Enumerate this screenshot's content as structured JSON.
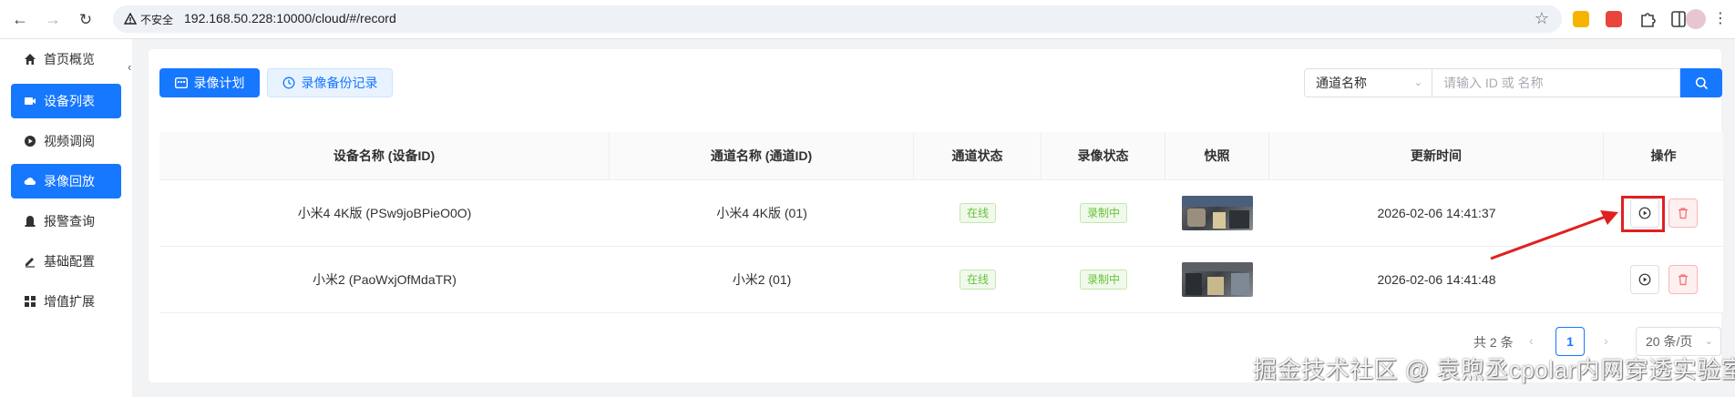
{
  "browser": {
    "insecure_label": "不安全",
    "url": "192.168.50.228:10000/cloud/#/record"
  },
  "sidebar": {
    "items": [
      {
        "label": "首页概览",
        "icon": "home-icon",
        "active": false
      },
      {
        "label": "设备列表",
        "icon": "camera-icon",
        "active": true
      },
      {
        "label": "视频调阅",
        "icon": "play-circle-icon",
        "active": false
      },
      {
        "label": "录像回放",
        "icon": "cloud-icon",
        "active": true
      },
      {
        "label": "报警查询",
        "icon": "alarm-icon",
        "active": false
      },
      {
        "label": "基础配置",
        "icon": "edit-icon",
        "active": false
      },
      {
        "label": "增值扩展",
        "icon": "grid-icon",
        "active": false
      }
    ]
  },
  "toolbar": {
    "plan_label": "录像计划",
    "backup_label": "录像备份记录"
  },
  "search": {
    "select_value": "通道名称",
    "placeholder": "请输入 ID 或 名称"
  },
  "table": {
    "columns": [
      "设备名称 (设备ID)",
      "通道名称 (通道ID)",
      "通道状态",
      "录像状态",
      "快照",
      "更新时间",
      "操作"
    ],
    "rows": [
      {
        "device": "小米4 4K版 (PSw9joBPieO0O)",
        "channel": "小米4 4K版 (01)",
        "channel_status": "在线",
        "record_status": "录制中",
        "updated": "2026-02-06 14:41:37"
      },
      {
        "device": "小米2 (PaoWxjOfMdaTR)",
        "channel": "小米2 (01)",
        "channel_status": "在线",
        "record_status": "录制中",
        "updated": "2026-02-06 14:41:48"
      }
    ]
  },
  "pagination": {
    "total": "共 2 条",
    "page": "1",
    "page_size": "20 条/页"
  },
  "watermark": "掘金技术社区 @ 袁煦丞cpolar内网穿透实验室",
  "colors": {
    "primary": "#1677ff",
    "success": "#67c23a",
    "danger": "#f56c6c",
    "annotation_red": "#e02020"
  }
}
